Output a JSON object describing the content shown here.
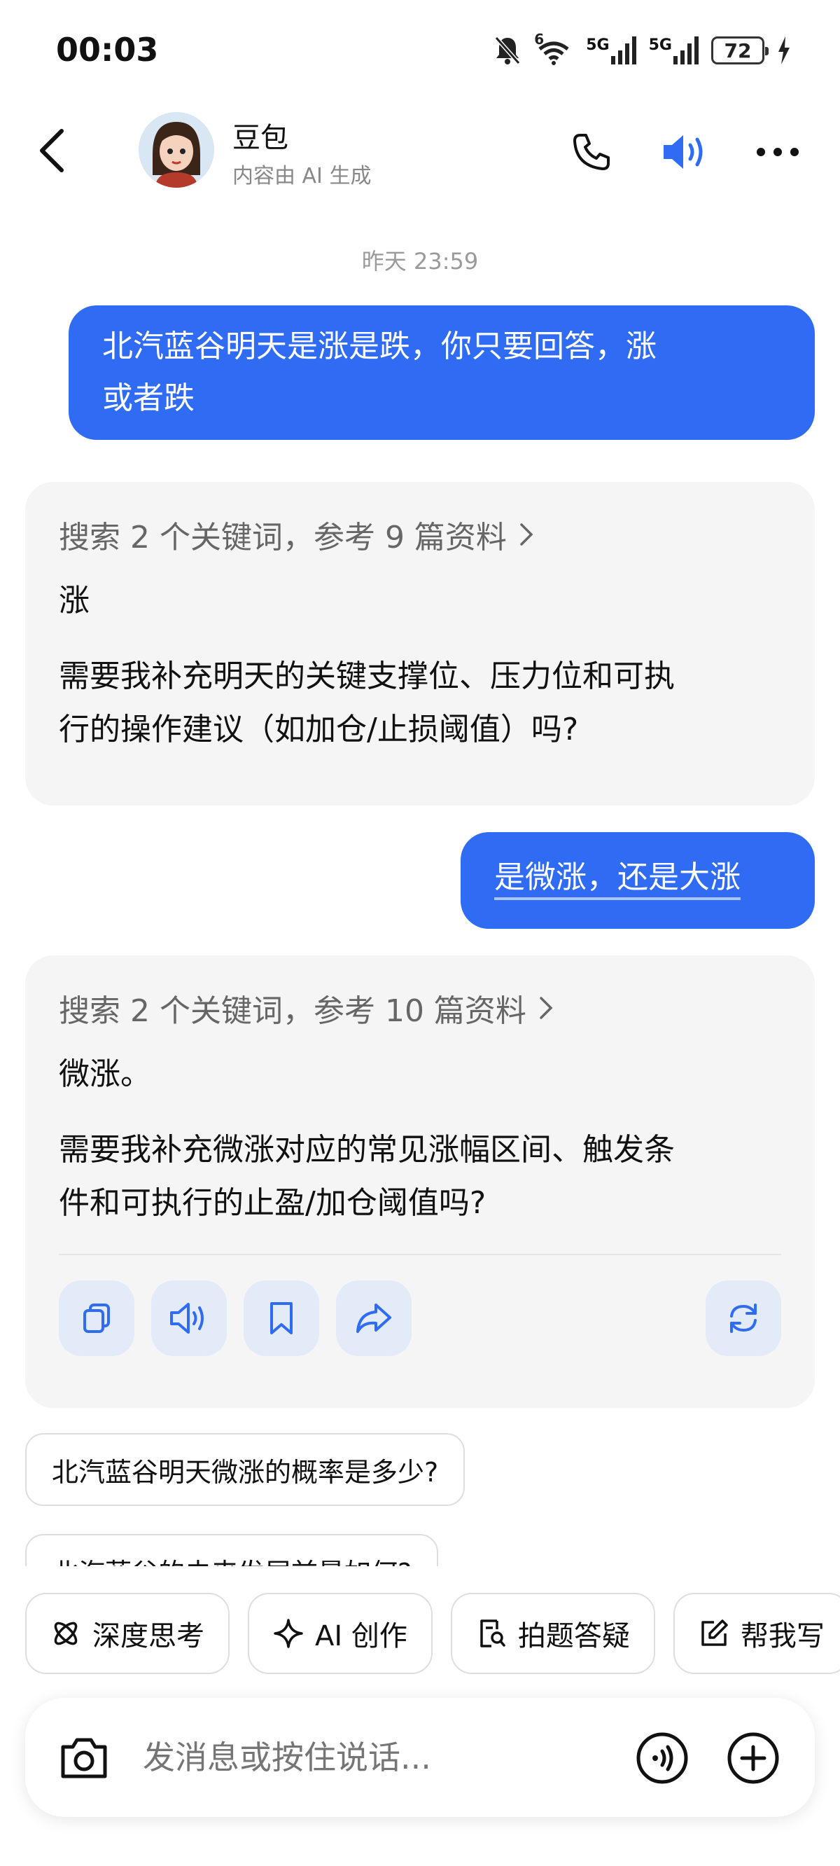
{
  "status_bar": {
    "time": "00:03",
    "battery": "72",
    "net1": "5G",
    "net2": "5G",
    "wifi_badge": "6"
  },
  "header": {
    "title": "豆包",
    "subtitle": "内容由 AI 生成"
  },
  "chat": {
    "timestamp": "昨天 23:59",
    "messages": [
      {
        "role": "user",
        "line1": "北汽蓝谷明天是涨是跌，你只要回答，涨",
        "line2": "或者跌"
      },
      {
        "role": "bot",
        "search": "搜索 2 个关键词，参考 9 篇资料",
        "answer": "涨",
        "line1": "需要我补充明天的关键支撑位、压力位和可执",
        "line2": "行的操作建议（如加仓/止损阈值）吗?"
      },
      {
        "role": "user",
        "text": "是微涨，还是大涨"
      },
      {
        "role": "bot",
        "search": "搜索 2 个关键词，参考 10 篇资料",
        "answer": "微涨。",
        "line1": "需要我补充微涨对应的常见涨幅区间、触发条",
        "line2": "件和可执行的止盈/加仓阈值吗?"
      }
    ]
  },
  "suggestions": [
    "北汽蓝谷明天微涨的概率是多少?",
    "北汽蓝谷的未来发展前景如何?"
  ],
  "tools": [
    {
      "label": "深度思考",
      "icon": "atom-icon"
    },
    {
      "label": "AI 创作",
      "icon": "sparkle-icon"
    },
    {
      "label": "拍题答疑",
      "icon": "doc-search-icon"
    },
    {
      "label": "帮我写",
      "icon": "edit-icon"
    }
  ],
  "input": {
    "placeholder": "发消息或按住说话..."
  },
  "colors": {
    "accent": "#2f6bf3",
    "bot_bubble": "#f5f5f5",
    "action_bg": "#e4ebf8"
  }
}
